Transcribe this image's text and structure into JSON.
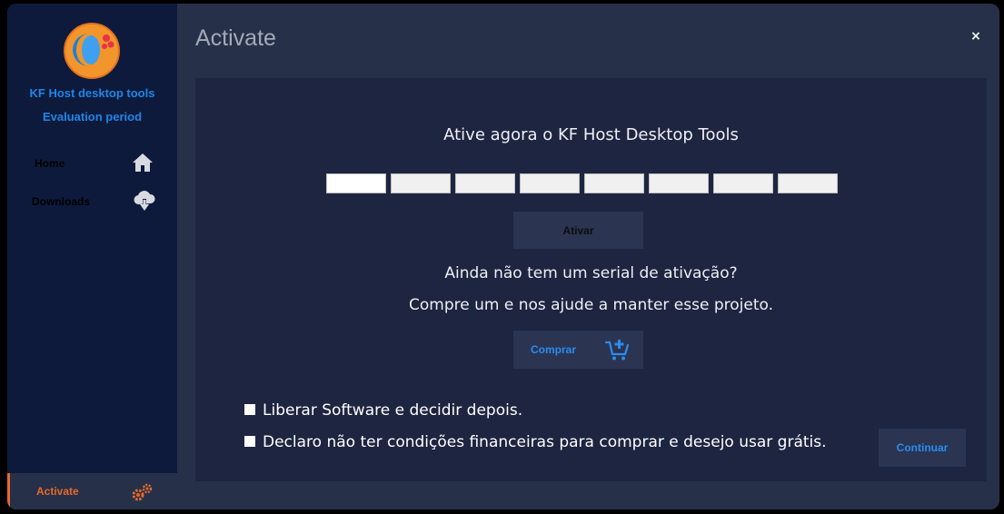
{
  "sidebar": {
    "brand_title": "KF Host desktop tools",
    "brand_subtitle": "Evaluation period",
    "items": [
      {
        "label": "Home",
        "icon": "home-icon"
      },
      {
        "label": "Downloads",
        "icon": "cloud-download-icon"
      }
    ],
    "footer_item": {
      "label": "Activate",
      "icon": "gears-icon"
    }
  },
  "header": {
    "title": "Activate",
    "close_label": "×"
  },
  "main": {
    "headline": "Ative agora o KF Host Desktop Tools",
    "serial_fields": [
      "",
      "",
      "",
      "",
      "",
      "",
      "",
      ""
    ],
    "activate_button": "Ativar",
    "question_line1": "Ainda não tem um serial de ativação?",
    "question_line2": "Compre um e nos ajude a manter esse projeto.",
    "buy_button": "Comprar",
    "option1": "Liberar Software e decidir depois.",
    "option2": "Declaro não ter condições financeiras para comprar e desejo usar grátis.",
    "continue_button": "Continuar"
  },
  "colors": {
    "accent": "#e8692a",
    "link_blue": "#2a8cf0",
    "sidebar_bg": "#0d1a3b",
    "panel_bg": "#1d2540",
    "window_bg": "#263049"
  }
}
